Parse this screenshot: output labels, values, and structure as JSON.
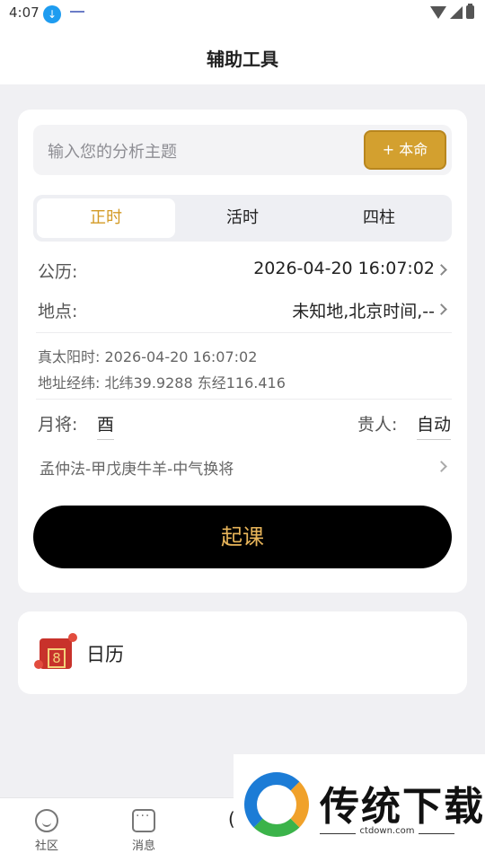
{
  "status_bar": {
    "time": "4:07",
    "icons": [
      "download-icon",
      "wifi-icon",
      "signal-icon",
      "battery-icon"
    ]
  },
  "header": {
    "title": "辅助工具"
  },
  "form": {
    "topic_placeholder": "输入您的分析主题",
    "benming_label": "+ 本命",
    "tabs": [
      {
        "label": "正时",
        "active": true
      },
      {
        "label": "活时",
        "active": false
      },
      {
        "label": "四柱",
        "active": false
      }
    ],
    "calendar_label": "公历:",
    "calendar_value": "2026-04-20 16:07:02",
    "location_label": "地点:",
    "location_value": "未知地,北京时间,--",
    "true_solar_time": "真太阳时: 2026-04-20 16:07:02",
    "coordinates": "地址经纬: 北纬39.9288 东经116.416",
    "yuejiang_label": "月将:",
    "yuejiang_value": "酉",
    "guiren_label": "贵人:",
    "guiren_value": "自动",
    "method": "孟仲法-甲戊庚牛羊-中气换将",
    "start_button": "起课"
  },
  "calendar_card": {
    "label": "日历",
    "icon_number": "8"
  },
  "bottom_nav": {
    "items": [
      {
        "label": "社区",
        "icon": "smile-icon"
      },
      {
        "label": "消息",
        "icon": "message-icon"
      }
    ],
    "partial_glyph": "("
  },
  "watermark": {
    "title": "传统下载",
    "url": "ctdown.com"
  },
  "colors": {
    "accent": "#d3a02f",
    "active_tab": "#d39a25",
    "start_text": "#e8b55a",
    "start_bg": "#000000"
  }
}
